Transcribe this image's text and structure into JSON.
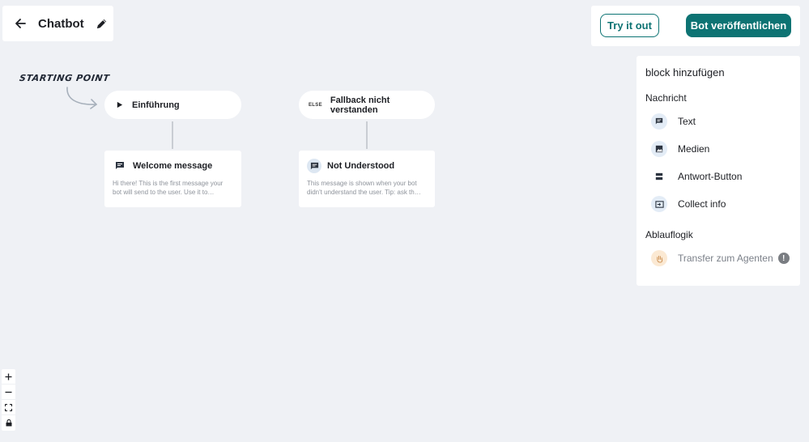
{
  "header": {
    "bot_name": "Chatbot",
    "try_label": "Try it out",
    "publish_label": "Bot veröffentlichen"
  },
  "canvas": {
    "starting_point_label": "STARTING POINT",
    "intro_pill": "Einführung",
    "fallback_tag": "ELSE",
    "fallback_pill": "Fallback nicht verstanden",
    "welcome": {
      "title": "Welcome message",
      "body": "Hi there! This is the first message your bot will send to the user. Use it to…"
    },
    "not_understood": {
      "title": "Not Understood",
      "body": "This message is shown when your bot didn't understand the user. Tip: ask th…"
    }
  },
  "sidebar": {
    "title": "block hinzufügen",
    "section_message": "Nachricht",
    "message_items": [
      {
        "label": "Text",
        "icon": "chat-bubble-icon"
      },
      {
        "label": "Medien",
        "icon": "image-icon"
      },
      {
        "label": "Antwort-Button",
        "icon": "button-icon"
      },
      {
        "label": "Collect info",
        "icon": "input-icon"
      }
    ],
    "section_flow": "Ablauflogik",
    "flow_items": [
      {
        "label": "Transfer zum Agenten",
        "icon": "hand-icon",
        "disabled": true,
        "warning": "!"
      }
    ]
  },
  "colors": {
    "accent": "#0d7373",
    "background": "#eff1f5",
    "card": "#ffffff"
  }
}
